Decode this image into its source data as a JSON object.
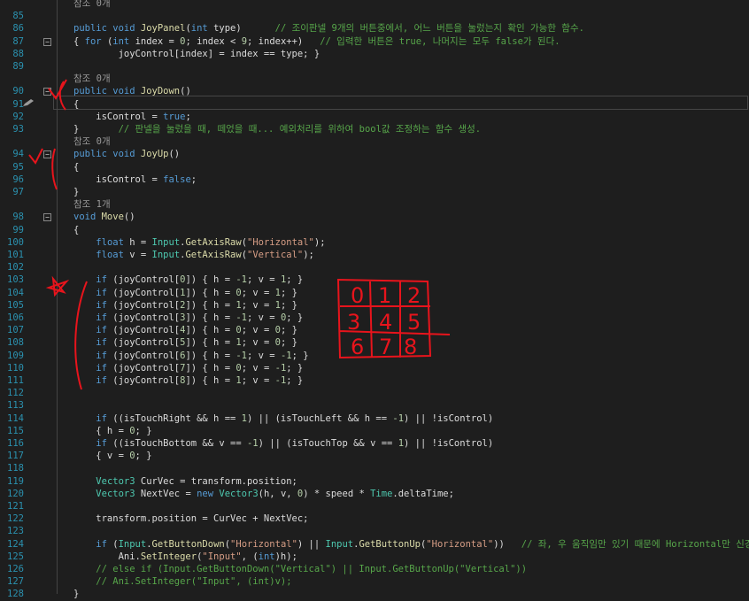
{
  "editor": {
    "lines": [
      {
        "n": "85",
        "hint": "참조 0개",
        "tokens": []
      },
      {
        "n": "86",
        "fold": false,
        "tokens": [
          [
            "k",
            "public "
          ],
          [
            "k",
            "void "
          ],
          [
            "f",
            "JoyPanel"
          ],
          [
            "p",
            "("
          ],
          [
            "k",
            "int "
          ],
          [
            "p",
            "type)      "
          ],
          [
            "c",
            "// 조이판넬 9개의 버튼중에서, 어느 버튼을 눌렀는지 확인 가능한 함수."
          ]
        ]
      },
      {
        "n": "87",
        "fold": true,
        "tokens": [
          [
            "p",
            "{ "
          ],
          [
            "k",
            "for "
          ],
          [
            "p",
            "("
          ],
          [
            "k",
            "int "
          ],
          [
            "p",
            "index = "
          ],
          [
            "n",
            "0"
          ],
          [
            "p",
            "; index < "
          ],
          [
            "n",
            "9"
          ],
          [
            "p",
            "; index++)   "
          ],
          [
            "c",
            "// 입력한 버튼은 true, 나머지는 모두 false가 된다."
          ]
        ]
      },
      {
        "n": "88",
        "tokens": [
          [
            "p",
            "        joyControl[index] = index == type; }"
          ]
        ]
      },
      {
        "n": "89",
        "tokens": []
      },
      {
        "n": "90",
        "hint": "참조 0개",
        "fold": true,
        "tokens": [
          [
            "k",
            "public "
          ],
          [
            "k",
            "void "
          ],
          [
            "f",
            "JoyDown"
          ],
          [
            "p",
            "()"
          ]
        ]
      },
      {
        "n": "91",
        "tokens": [
          [
            "p",
            "{"
          ]
        ]
      },
      {
        "n": "92",
        "tokens": [
          [
            "p",
            "    isControl = "
          ],
          [
            "k",
            "true"
          ],
          [
            "p",
            ";"
          ]
        ]
      },
      {
        "n": "93",
        "tokens": [
          [
            "p",
            "}       "
          ],
          [
            "c",
            "// 판넬을 눌렀을 때, 떼었을 때... 예외처리를 위하여 bool값 조정하는 함수 생성."
          ]
        ]
      },
      {
        "n": "94",
        "hint": "참조 0개",
        "fold": true,
        "tokens": [
          [
            "k",
            "public "
          ],
          [
            "k",
            "void "
          ],
          [
            "f",
            "JoyUp"
          ],
          [
            "p",
            "()"
          ]
        ]
      },
      {
        "n": "95",
        "tokens": [
          [
            "p",
            "{"
          ]
        ]
      },
      {
        "n": "96",
        "tokens": [
          [
            "p",
            "    isControl = "
          ],
          [
            "k",
            "false"
          ],
          [
            "p",
            ";"
          ]
        ]
      },
      {
        "n": "97",
        "tokens": [
          [
            "p",
            "}"
          ]
        ]
      },
      {
        "n": "98",
        "hint": "참조 1개",
        "fold": true,
        "tokens": [
          [
            "k",
            "void "
          ],
          [
            "f",
            "Move"
          ],
          [
            "p",
            "()"
          ]
        ]
      },
      {
        "n": "99",
        "tokens": [
          [
            "p",
            "{"
          ]
        ]
      },
      {
        "n": "100",
        "tokens": [
          [
            "p",
            "    "
          ],
          [
            "k",
            "float "
          ],
          [
            "p",
            "h = "
          ],
          [
            "t",
            "Input"
          ],
          [
            "p",
            "."
          ],
          [
            "f",
            "GetAxisRaw"
          ],
          [
            "p",
            "("
          ],
          [
            "s",
            "\"Horizontal\""
          ],
          [
            "p",
            ");"
          ]
        ]
      },
      {
        "n": "101",
        "tokens": [
          [
            "p",
            "    "
          ],
          [
            "k",
            "float "
          ],
          [
            "p",
            "v = "
          ],
          [
            "t",
            "Input"
          ],
          [
            "p",
            "."
          ],
          [
            "f",
            "GetAxisRaw"
          ],
          [
            "p",
            "("
          ],
          [
            "s",
            "\"Vertical\""
          ],
          [
            "p",
            ");"
          ]
        ]
      },
      {
        "n": "102",
        "tokens": []
      },
      {
        "n": "103",
        "tokens": [
          [
            "p",
            "    "
          ],
          [
            "k",
            "if "
          ],
          [
            "p",
            "(joyControl["
          ],
          [
            "n",
            "0"
          ],
          [
            "p",
            "]) { h = "
          ],
          [
            "n",
            "-1"
          ],
          [
            "p",
            "; v = "
          ],
          [
            "n",
            "1"
          ],
          [
            "p",
            "; }"
          ]
        ]
      },
      {
        "n": "104",
        "tokens": [
          [
            "p",
            "    "
          ],
          [
            "k",
            "if "
          ],
          [
            "p",
            "(joyControl["
          ],
          [
            "n",
            "1"
          ],
          [
            "p",
            "]) { h = "
          ],
          [
            "n",
            "0"
          ],
          [
            "p",
            "; v = "
          ],
          [
            "n",
            "1"
          ],
          [
            "p",
            "; }"
          ]
        ]
      },
      {
        "n": "105",
        "tokens": [
          [
            "p",
            "    "
          ],
          [
            "k",
            "if "
          ],
          [
            "p",
            "(joyControl["
          ],
          [
            "n",
            "2"
          ],
          [
            "p",
            "]) { h = "
          ],
          [
            "n",
            "1"
          ],
          [
            "p",
            "; v = "
          ],
          [
            "n",
            "1"
          ],
          [
            "p",
            "; }"
          ]
        ]
      },
      {
        "n": "106",
        "tokens": [
          [
            "p",
            "    "
          ],
          [
            "k",
            "if "
          ],
          [
            "p",
            "(joyControl["
          ],
          [
            "n",
            "3"
          ],
          [
            "p",
            "]) { h = "
          ],
          [
            "n",
            "-1"
          ],
          [
            "p",
            "; v = "
          ],
          [
            "n",
            "0"
          ],
          [
            "p",
            "; }"
          ]
        ]
      },
      {
        "n": "107",
        "tokens": [
          [
            "p",
            "    "
          ],
          [
            "k",
            "if "
          ],
          [
            "p",
            "(joyControl["
          ],
          [
            "n",
            "4"
          ],
          [
            "p",
            "]) { h = "
          ],
          [
            "n",
            "0"
          ],
          [
            "p",
            "; v = "
          ],
          [
            "n",
            "0"
          ],
          [
            "p",
            "; }"
          ]
        ]
      },
      {
        "n": "108",
        "tokens": [
          [
            "p",
            "    "
          ],
          [
            "k",
            "if "
          ],
          [
            "p",
            "(joyControl["
          ],
          [
            "n",
            "5"
          ],
          [
            "p",
            "]) { h = "
          ],
          [
            "n",
            "1"
          ],
          [
            "p",
            "; v = "
          ],
          [
            "n",
            "0"
          ],
          [
            "p",
            "; }"
          ]
        ]
      },
      {
        "n": "109",
        "tokens": [
          [
            "p",
            "    "
          ],
          [
            "k",
            "if "
          ],
          [
            "p",
            "(joyControl["
          ],
          [
            "n",
            "6"
          ],
          [
            "p",
            "]) { h = "
          ],
          [
            "n",
            "-1"
          ],
          [
            "p",
            "; v = "
          ],
          [
            "n",
            "-1"
          ],
          [
            "p",
            "; }"
          ]
        ]
      },
      {
        "n": "110",
        "tokens": [
          [
            "p",
            "    "
          ],
          [
            "k",
            "if "
          ],
          [
            "p",
            "(joyControl["
          ],
          [
            "n",
            "7"
          ],
          [
            "p",
            "]) { h = "
          ],
          [
            "n",
            "0"
          ],
          [
            "p",
            "; v = "
          ],
          [
            "n",
            "-1"
          ],
          [
            "p",
            "; }"
          ]
        ]
      },
      {
        "n": "111",
        "tokens": [
          [
            "p",
            "    "
          ],
          [
            "k",
            "if "
          ],
          [
            "p",
            "(joyControl["
          ],
          [
            "n",
            "8"
          ],
          [
            "p",
            "]) { h = "
          ],
          [
            "n",
            "1"
          ],
          [
            "p",
            "; v = "
          ],
          [
            "n",
            "-1"
          ],
          [
            "p",
            "; }"
          ]
        ]
      },
      {
        "n": "112",
        "tokens": []
      },
      {
        "n": "113",
        "tokens": []
      },
      {
        "n": "114",
        "tokens": [
          [
            "p",
            "    "
          ],
          [
            "k",
            "if "
          ],
          [
            "p",
            "((isTouchRight && h == "
          ],
          [
            "n",
            "1"
          ],
          [
            "p",
            ") || (isTouchLeft && h == "
          ],
          [
            "n",
            "-1"
          ],
          [
            "p",
            ") || !isControl)"
          ]
        ]
      },
      {
        "n": "115",
        "tokens": [
          [
            "p",
            "    { h = "
          ],
          [
            "n",
            "0"
          ],
          [
            "p",
            "; }"
          ]
        ]
      },
      {
        "n": "116",
        "tokens": [
          [
            "p",
            "    "
          ],
          [
            "k",
            "if "
          ],
          [
            "p",
            "((isTouchBottom && v == "
          ],
          [
            "n",
            "-1"
          ],
          [
            "p",
            ") || (isTouchTop && v == "
          ],
          [
            "n",
            "1"
          ],
          [
            "p",
            ") || !isControl)"
          ]
        ]
      },
      {
        "n": "117",
        "tokens": [
          [
            "p",
            "    { v = "
          ],
          [
            "n",
            "0"
          ],
          [
            "p",
            "; }"
          ]
        ]
      },
      {
        "n": "118",
        "tokens": []
      },
      {
        "n": "119",
        "tokens": [
          [
            "p",
            "    "
          ],
          [
            "t",
            "Vector3 "
          ],
          [
            "p",
            "CurVec = transform.position;"
          ]
        ]
      },
      {
        "n": "120",
        "tokens": [
          [
            "p",
            "    "
          ],
          [
            "t",
            "Vector3 "
          ],
          [
            "p",
            "NextVec = "
          ],
          [
            "k",
            "new "
          ],
          [
            "t",
            "Vector3"
          ],
          [
            "p",
            "(h, v, "
          ],
          [
            "n",
            "0"
          ],
          [
            "p",
            ") * speed * "
          ],
          [
            "t",
            "Time"
          ],
          [
            "p",
            ".deltaTime;"
          ]
        ]
      },
      {
        "n": "121",
        "tokens": []
      },
      {
        "n": "122",
        "tokens": [
          [
            "p",
            "    transform.position = CurVec + NextVec;"
          ]
        ]
      },
      {
        "n": "123",
        "tokens": []
      },
      {
        "n": "124",
        "tokens": [
          [
            "p",
            "    "
          ],
          [
            "k",
            "if "
          ],
          [
            "p",
            "("
          ],
          [
            "t",
            "Input"
          ],
          [
            "p",
            "."
          ],
          [
            "f",
            "GetButtonDown"
          ],
          [
            "p",
            "("
          ],
          [
            "s",
            "\"Horizontal\""
          ],
          [
            "p",
            ") || "
          ],
          [
            "t",
            "Input"
          ],
          [
            "p",
            "."
          ],
          [
            "f",
            "GetButtonUp"
          ],
          [
            "p",
            "("
          ],
          [
            "s",
            "\"Horizontal\""
          ],
          [
            "p",
            "))   "
          ],
          [
            "c",
            "// 좌, 우 움직임만 있기 때문에 Horizontal만 신경쓰면"
          ]
        ]
      },
      {
        "n": "125",
        "tokens": [
          [
            "p",
            "        Ani."
          ],
          [
            "f",
            "SetInteger"
          ],
          [
            "p",
            "("
          ],
          [
            "s",
            "\"Input\""
          ],
          [
            "p",
            ", ("
          ],
          [
            "k",
            "int"
          ],
          [
            "p",
            ")h);"
          ]
        ]
      },
      {
        "n": "126",
        "tokens": [
          [
            "c",
            "    // else if (Input.GetButtonDown(\"Vertical\") || Input.GetButtonUp(\"Vertical\"))"
          ]
        ]
      },
      {
        "n": "127",
        "tokens": [
          [
            "c",
            "    // Ani.SetInteger(\"Input\", (int)v);"
          ]
        ]
      },
      {
        "n": "128",
        "tokens": [
          [
            "p",
            "}"
          ]
        ]
      }
    ]
  },
  "annotation": {
    "grid_digits": [
      "0",
      "1",
      "2",
      "3",
      "4",
      "5",
      "6",
      "7",
      "8"
    ],
    "ink_color": "#e8141c"
  }
}
